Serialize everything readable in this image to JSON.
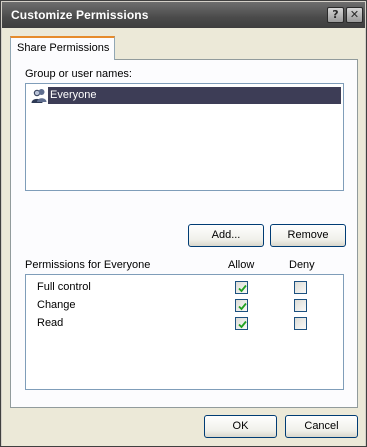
{
  "window": {
    "title": "Customize Permissions"
  },
  "titlebar_buttons": {
    "help": "?",
    "close": "✕"
  },
  "tab": {
    "label": "Share Permissions"
  },
  "group_section": {
    "label": "Group or user names:",
    "items": [
      {
        "name": "Everyone",
        "selected": true,
        "icon": "users-group-icon"
      }
    ]
  },
  "group_buttons": {
    "add": "Add...",
    "remove": "Remove"
  },
  "permissions": {
    "header": "Permissions for Everyone",
    "allow_header": "Allow",
    "deny_header": "Deny",
    "rows": [
      {
        "name": "Full control",
        "allow": true,
        "deny": false
      },
      {
        "name": "Change",
        "allow": true,
        "deny": false
      },
      {
        "name": "Read",
        "allow": true,
        "deny": false
      }
    ]
  },
  "dialog_buttons": {
    "ok": "OK",
    "cancel": "Cancel"
  }
}
